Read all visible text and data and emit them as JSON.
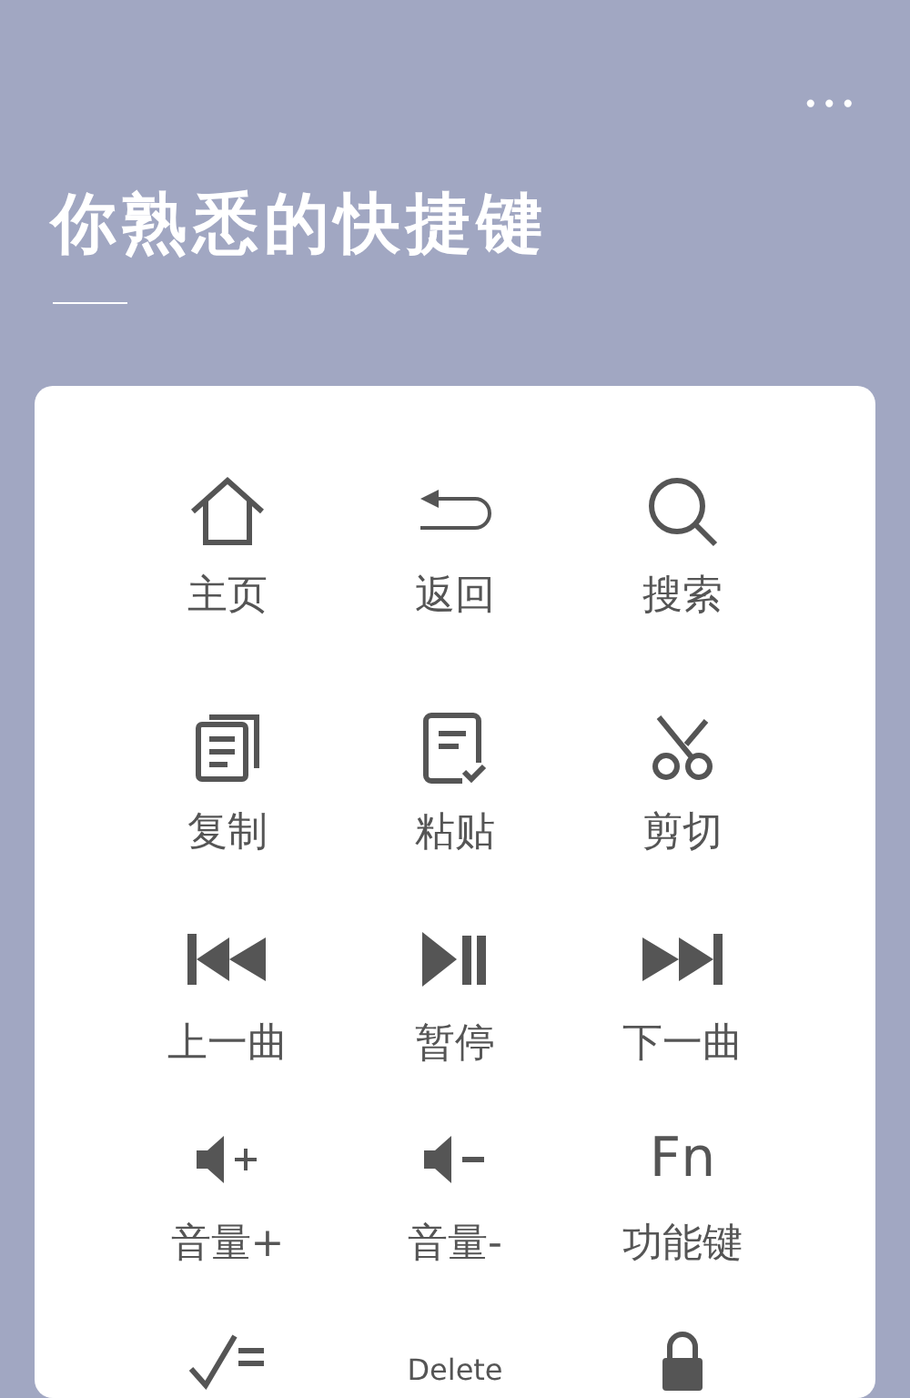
{
  "header": {
    "menu": "•••",
    "title": "你熟悉的快捷键"
  },
  "rows": [
    {
      "shortcuts": [
        {
          "kind": "icon",
          "label": "主页"
        },
        {
          "kind": "icon",
          "label": "返回"
        },
        {
          "kind": "icon",
          "label": "搜索"
        }
      ]
    },
    {
      "shortcuts": [
        {
          "kind": "icon",
          "label": "复制"
        },
        {
          "kind": "icon",
          "label": "粘贴"
        },
        {
          "kind": "icon",
          "label": "剪切"
        }
      ]
    },
    {
      "shortcuts": [
        {
          "kind": "icon",
          "label": "上一曲"
        },
        {
          "kind": "icon",
          "label": "暂停"
        },
        {
          "kind": "icon",
          "label": "下一曲"
        }
      ]
    },
    {
      "shortcuts": [
        {
          "kind": "icon",
          "label": "音量+"
        },
        {
          "kind": "icon",
          "label": "音量-"
        },
        {
          "kind": "glyph",
          "glyph": "Fn",
          "label": "功能键"
        }
      ]
    },
    {
      "shortcuts": [
        {
          "kind": "icon"
        },
        {
          "kind": "glyph",
          "glyph": "Delete"
        },
        {
          "kind": "icon"
        }
      ]
    }
  ]
}
